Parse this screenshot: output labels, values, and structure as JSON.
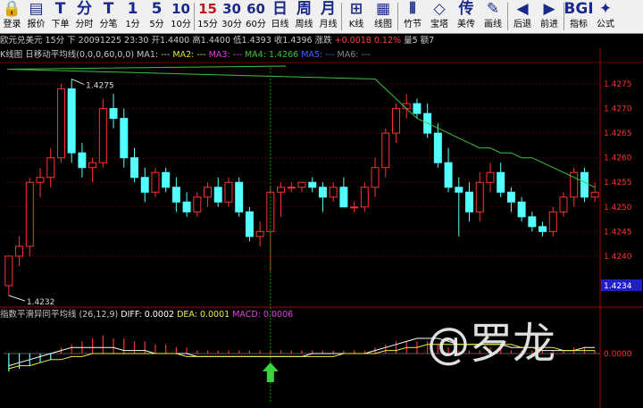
{
  "toolbar": {
    "items": [
      {
        "icon": "🔒",
        "label": "登录",
        "icon_name": "login-icon"
      },
      {
        "icon": "▤",
        "label": "报价",
        "icon_name": "quote-icon"
      },
      {
        "icon": "T",
        "label": "下单",
        "icon_name": "order-icon"
      },
      {
        "icon": "分",
        "label": "分时",
        "icon_name": "timeshare-icon"
      },
      {
        "icon": "T",
        "label": "分笔",
        "icon_name": "tick-icon"
      },
      {
        "icon": "1",
        "label": "1分",
        "icon_name": "1min-icon"
      },
      {
        "icon": "5",
        "label": "5分",
        "icon_name": "5min-icon"
      },
      {
        "icon": "10",
        "label": "10分",
        "icon_name": "10min-icon"
      },
      {
        "icon": "15",
        "label": "15分",
        "icon_name": "15min-icon",
        "active": true
      },
      {
        "icon": "30",
        "label": "30分",
        "icon_name": "30min-icon"
      },
      {
        "icon": "60",
        "label": "60分",
        "icon_name": "60min-icon"
      },
      {
        "icon": "日",
        "label": "日线",
        "icon_name": "daily-icon"
      },
      {
        "icon": "周",
        "label": "周线",
        "icon_name": "weekly-icon"
      },
      {
        "icon": "月",
        "label": "月线",
        "icon_name": "monthly-icon"
      },
      {
        "icon": "⊞",
        "label": "K线",
        "icon_name": "kline-icon"
      },
      {
        "icon": "▦",
        "label": "线图",
        "icon_name": "linechart-icon"
      },
      {
        "icon": "⫴",
        "label": "竹节",
        "icon_name": "bamboo-icon"
      },
      {
        "icon": "◇",
        "label": "宝塔",
        "icon_name": "tower-icon"
      },
      {
        "icon": "传",
        "label": "美传",
        "icon_name": "transmit-icon"
      },
      {
        "icon": "✎",
        "label": "画线",
        "icon_name": "draw-icon"
      },
      {
        "icon": "◀",
        "label": "后退",
        "icon_name": "back-icon"
      },
      {
        "icon": "▶",
        "label": "前进",
        "icon_name": "forward-icon"
      },
      {
        "icon": "BGI",
        "label": "指标",
        "icon_name": "indicator-icon"
      },
      {
        "icon": "✦",
        "label": "公式",
        "icon_name": "formula-icon"
      }
    ]
  },
  "status": {
    "symbol": "欧元兑美元 15分 下",
    "datetime": "20091225 23:30",
    "open": "开1.4400",
    "high": "高1.4400",
    "low": "低1.4393",
    "close": "收1.4396",
    "change_label": "涨跌",
    "change": "+0.0018 0.12%",
    "volume": "量5",
    "position": "额7"
  },
  "ma_legend": {
    "title": "K线图",
    "indicator": "日移动平均线",
    "params": "(0,0,0,60,0,0)",
    "ma1": "MA1: ---",
    "ma2": "MA2: ---",
    "ma3": "MA3: ---",
    "ma4": "MA4: 1.4266",
    "ma5": "MA5: ---",
    "ma6": "MA6: ---"
  },
  "macd_legend": {
    "title": "指数平滑异同平均线",
    "params": "(26,12,9)",
    "diff": "DIFF: 0.0002",
    "dea": "DEA: 0.0001",
    "macd": "MACD: 0.0006"
  },
  "colors": {
    "up": "#ff3232",
    "down": "#54ffff",
    "ma4": "#3ec03e",
    "diff_line": "#ffffff",
    "dea_line": "#f0f040",
    "arrow": "#3ed23e",
    "grid": "#7a0000",
    "current_price_bg": "#2020c0"
  },
  "price_axis": {
    "ticks": [
      "1.4275",
      "1.4270",
      "1.4265",
      "1.4260",
      "1.4255",
      "1.4250",
      "1.4245",
      "1.4240"
    ],
    "current_price": "1.4234",
    "macd_ticks": [
      "0.0000"
    ]
  },
  "chart_data": {
    "type": "candlestick",
    "ylim": [
      1.423,
      1.4279
    ],
    "high_label": "1.4275",
    "low_label": "1.4232",
    "candles": [
      [
        1.4234,
        1.424,
        1.4232,
        1.424
      ],
      [
        1.424,
        1.4244,
        1.4238,
        1.4242
      ],
      [
        1.4242,
        1.4256,
        1.424,
        1.4255
      ],
      [
        1.4255,
        1.4258,
        1.4252,
        1.4256
      ],
      [
        1.4256,
        1.4262,
        1.4254,
        1.426
      ],
      [
        1.426,
        1.4275,
        1.4259,
        1.4274
      ],
      [
        1.4274,
        1.4276,
        1.4259,
        1.4261
      ],
      [
        1.4261,
        1.4263,
        1.4256,
        1.4258
      ],
      [
        1.4258,
        1.426,
        1.4255,
        1.4259
      ],
      [
        1.4259,
        1.4272,
        1.4258,
        1.427
      ],
      [
        1.427,
        1.4273,
        1.4266,
        1.4268
      ],
      [
        1.4268,
        1.427,
        1.4258,
        1.426
      ],
      [
        1.426,
        1.4262,
        1.4255,
        1.4256
      ],
      [
        1.4256,
        1.4258,
        1.4251,
        1.4253
      ],
      [
        1.4253,
        1.4258,
        1.4252,
        1.4257
      ],
      [
        1.4257,
        1.4258,
        1.4253,
        1.4254
      ],
      [
        1.4254,
        1.4256,
        1.4249,
        1.4251
      ],
      [
        1.4251,
        1.4253,
        1.4248,
        1.4249
      ],
      [
        1.4249,
        1.4253,
        1.4248,
        1.4252
      ],
      [
        1.4252,
        1.4255,
        1.425,
        1.4254
      ],
      [
        1.4254,
        1.4256,
        1.425,
        1.4251
      ],
      [
        1.4251,
        1.4256,
        1.425,
        1.4255
      ],
      [
        1.4255,
        1.4256,
        1.4248,
        1.4249
      ],
      [
        1.4249,
        1.425,
        1.4243,
        1.4244
      ],
      [
        1.4244,
        1.4247,
        1.4242,
        1.4245
      ],
      [
        1.4245,
        1.4254,
        1.4237,
        1.4253
      ],
      [
        1.4253,
        1.4255,
        1.4248,
        1.4254
      ],
      [
        1.4254,
        1.4255,
        1.4253,
        1.4254
      ],
      [
        1.4254,
        1.4255,
        1.4253,
        1.4255
      ],
      [
        1.4255,
        1.4256,
        1.4253,
        1.4254
      ],
      [
        1.4254,
        1.4255,
        1.4249,
        1.4252
      ],
      [
        1.4252,
        1.4255,
        1.4251,
        1.4254
      ],
      [
        1.4254,
        1.4256,
        1.425,
        1.425
      ],
      [
        1.425,
        1.4251,
        1.4249,
        1.425
      ],
      [
        1.425,
        1.4255,
        1.4249,
        1.4254
      ],
      [
        1.4254,
        1.426,
        1.4252,
        1.4258
      ],
      [
        1.4258,
        1.4266,
        1.4256,
        1.4265
      ],
      [
        1.4265,
        1.4271,
        1.4263,
        1.427
      ],
      [
        1.427,
        1.4273,
        1.4268,
        1.4271
      ],
      [
        1.4271,
        1.4272,
        1.4268,
        1.4269
      ],
      [
        1.4269,
        1.4271,
        1.4264,
        1.4265
      ],
      [
        1.4265,
        1.4267,
        1.4258,
        1.4259
      ],
      [
        1.4259,
        1.4262,
        1.4253,
        1.4254
      ],
      [
        1.4254,
        1.4256,
        1.4244,
        1.4253
      ],
      [
        1.4253,
        1.4255,
        1.4247,
        1.4249
      ],
      [
        1.4249,
        1.4257,
        1.4247,
        1.4255
      ],
      [
        1.4255,
        1.4259,
        1.4253,
        1.4257
      ],
      [
        1.4257,
        1.4259,
        1.4252,
        1.4253
      ],
      [
        1.4253,
        1.4254,
        1.4249,
        1.4251
      ],
      [
        1.4251,
        1.4252,
        1.4247,
        1.4248
      ],
      [
        1.4248,
        1.4249,
        1.4245,
        1.4246
      ],
      [
        1.4246,
        1.4247,
        1.4244,
        1.4245
      ],
      [
        1.4245,
        1.425,
        1.4244,
        1.4249
      ],
      [
        1.4249,
        1.4253,
        1.4248,
        1.4252
      ],
      [
        1.4252,
        1.4258,
        1.425,
        1.4257
      ],
      [
        1.4257,
        1.4258,
        1.4251,
        1.4252
      ],
      [
        1.4252,
        1.4255,
        1.4251,
        1.4253
      ]
    ],
    "ma4": [
      null,
      null,
      null,
      null,
      null,
      null,
      null,
      null,
      null,
      null,
      null,
      null,
      null,
      null,
      null,
      null,
      null,
      null,
      null,
      null,
      null,
      null,
      null,
      null,
      null,
      null,
      null,
      null,
      null,
      null,
      null,
      null,
      null,
      null,
      1.4278,
      1.4276,
      1.4274,
      1.4272,
      1.427,
      1.4268,
      1.4267,
      1.4266,
      1.4265,
      1.4264,
      1.4263,
      1.4262,
      1.4262,
      1.4261,
      1.4261,
      1.426,
      1.426,
      1.4259,
      1.4258,
      1.4257,
      1.4256,
      1.4255,
      1.4254
    ],
    "macd": {
      "ylim": [
        -0.001,
        0.001
      ],
      "hist": [
        -0.0006,
        -0.0005,
        -0.0004,
        -0.0003,
        -0.0002,
        0.0002,
        0.0003,
        0.0004,
        0.0005,
        0.0006,
        0.0005,
        0.0005,
        0.0004,
        0.0004,
        0.0003,
        0.0003,
        0.0002,
        0.0002,
        0.0001,
        0.0001,
        0.0001,
        0.0001,
        0.0001,
        0.0001,
        0.0001,
        0.0001,
        0.0001,
        0.0001,
        0.0001,
        0.0001,
        0.0001,
        0.0001,
        0.0001,
        0.0001,
        0.0001,
        0.0002,
        0.0003,
        0.0004,
        0.0004,
        0.0004,
        0.0004,
        0.0003,
        0.0002,
        0.0001,
        0.0001,
        0.0001,
        0.0002,
        0.0002,
        0.0001,
        0.0001,
        0.0001,
        0.0001,
        0.0001,
        0.0001,
        0.0002,
        0.0002,
        0.0001
      ],
      "diff": [
        -0.0004,
        -0.0003,
        -0.0002,
        -0.0001,
        0.0,
        0.0001,
        0.0002,
        0.0002,
        0.0002,
        0.0002,
        0.0002,
        0.0001,
        0.0001,
        0.0001,
        0.0,
        0.0,
        0.0,
        0.0,
        -0.0001,
        -0.0001,
        -0.0001,
        -0.0001,
        -0.0001,
        -0.0001,
        -0.0001,
        -0.0001,
        -0.0001,
        -0.0001,
        -0.0001,
        0.0,
        0.0,
        0.0,
        0.0,
        0.0,
        0.0,
        0.0001,
        0.0002,
        0.0003,
        0.0004,
        0.0005,
        0.0005,
        0.0005,
        0.0004,
        0.0003,
        0.0003,
        0.0003,
        0.0003,
        0.0003,
        0.0002,
        0.0002,
        0.0002,
        0.0001,
        0.0001,
        0.0001,
        0.0001,
        0.0002,
        0.0002
      ],
      "dea": [
        -0.0005,
        -0.0004,
        -0.0004,
        -0.0003,
        -0.0002,
        -0.0002,
        -0.0001,
        -0.0001,
        0.0,
        0.0,
        0.0,
        0.0,
        0.0,
        0.0,
        0.0,
        0.0,
        0.0,
        -0.0001,
        -0.0001,
        -0.0001,
        -0.0001,
        -0.0001,
        -0.0001,
        -0.0001,
        -0.0001,
        -0.0001,
        -0.0001,
        -0.0001,
        -0.0001,
        -0.0001,
        -0.0001,
        -0.0001,
        0.0,
        0.0,
        0.0,
        0.0,
        0.0001,
        0.0001,
        0.0002,
        0.0002,
        0.0003,
        0.0003,
        0.0003,
        0.0003,
        0.0003,
        0.0003,
        0.0003,
        0.0003,
        0.0003,
        0.0002,
        0.0002,
        0.0002,
        0.0002,
        0.0001,
        0.0001,
        0.0001,
        0.0001
      ]
    },
    "signal_arrow_index": 25
  },
  "watermark": "@罗龙"
}
